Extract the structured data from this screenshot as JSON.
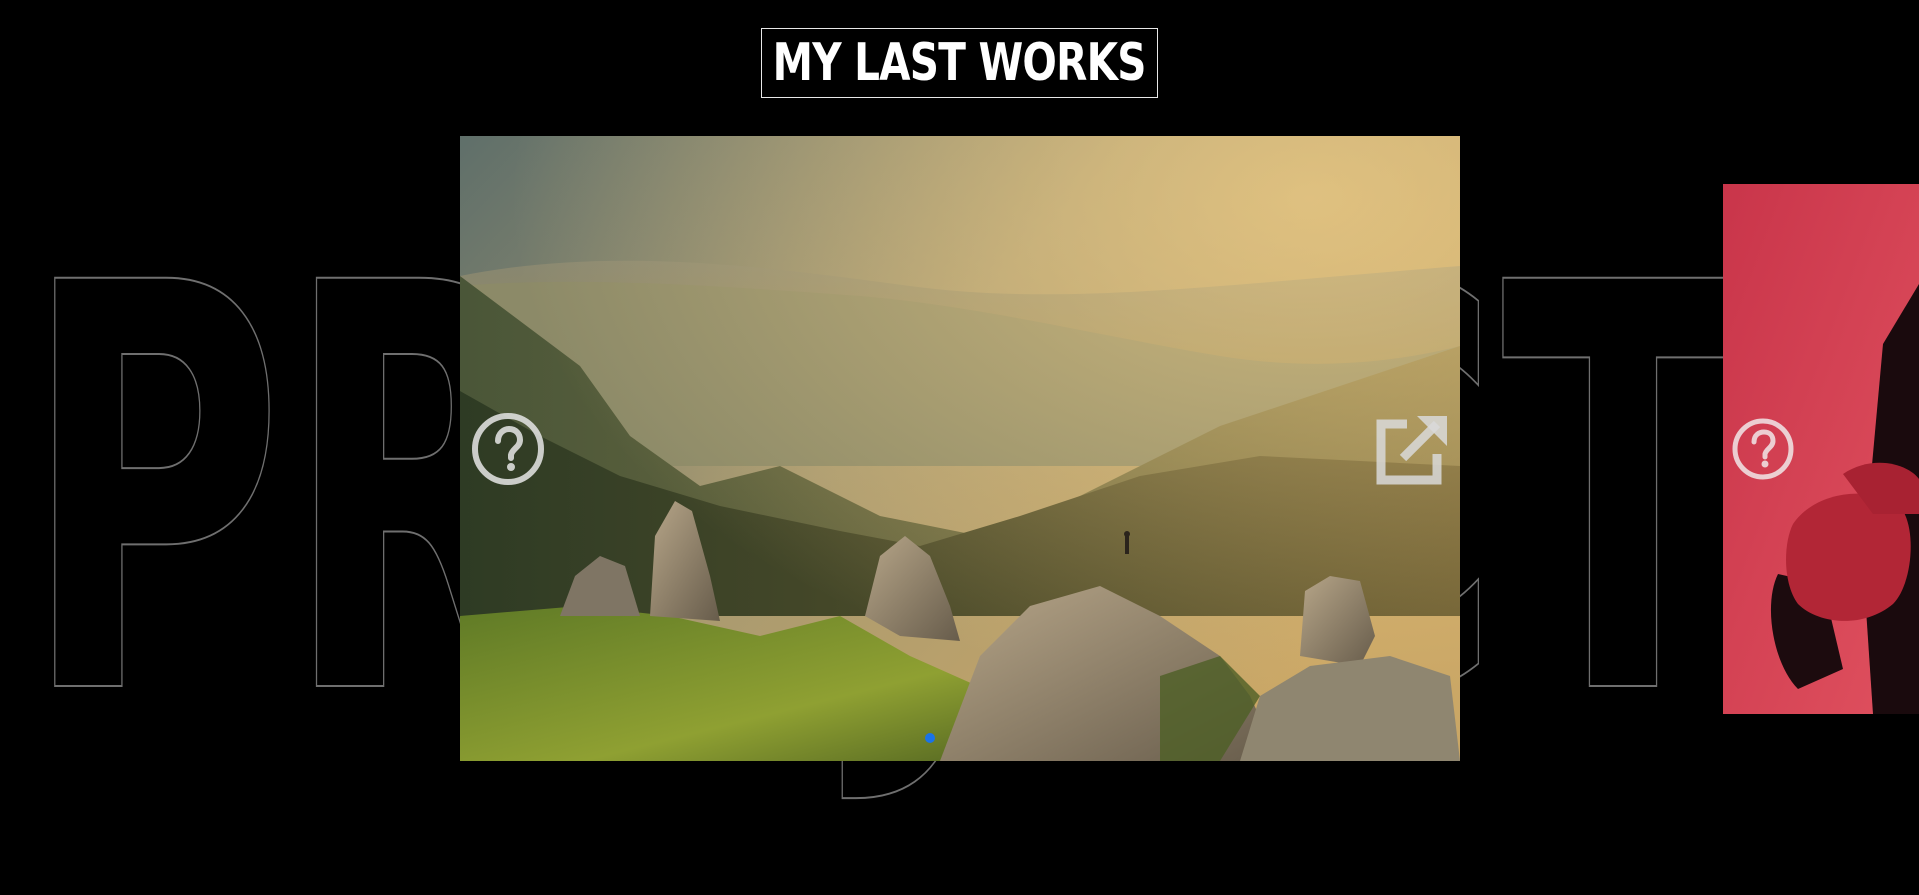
{
  "section": {
    "title": "MY LAST WORKS",
    "background_word": "PROJECTS"
  },
  "slides": [
    {
      "name": "mountain-landscape",
      "icons": [
        "question-circle-icon",
        "external-link-icon"
      ]
    },
    {
      "name": "red-portrait",
      "icons": [
        "question-circle-icon"
      ]
    }
  ],
  "pagination": {
    "active_color": "#1a73e8",
    "active_index": 0
  },
  "colors": {
    "background": "#000000",
    "outline_text": "#6f6f6f",
    "accent_red": "#d53a4e"
  }
}
